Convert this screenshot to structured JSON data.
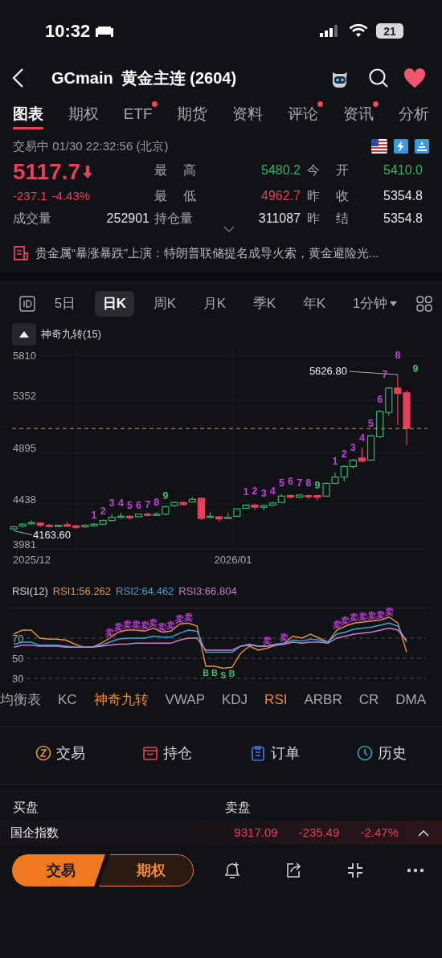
{
  "status_bar": {
    "time": "10:32",
    "battery": "21"
  },
  "header": {
    "symbol": "GCmain",
    "name": "黄金主连 (2604)",
    "favorite": true
  },
  "tabs": [
    {
      "label": "图表",
      "selected": true,
      "badge": false
    },
    {
      "label": "期权",
      "selected": false,
      "badge": false
    },
    {
      "label": "ETF",
      "selected": false,
      "badge": true
    },
    {
      "label": "期货",
      "selected": false,
      "badge": false
    },
    {
      "label": "资料",
      "selected": false,
      "badge": false
    },
    {
      "label": "评论",
      "selected": false,
      "badge": true
    },
    {
      "label": "资讯",
      "selected": false,
      "badge": true
    },
    {
      "label": "分析",
      "selected": false,
      "badge": false
    }
  ],
  "session": "交易中 01/30 22:32:56 (北京)",
  "quote": {
    "price": "5117.7",
    "change": "-237.1",
    "change_pct": "-4.43%",
    "color": "#e8405a"
  },
  "stats": [
    {
      "label": "最 高",
      "value": "5480.2",
      "color": "#34b36d"
    },
    {
      "label": "今 开",
      "value": "5410.0",
      "color": "#34b36d"
    },
    {
      "label": "最 低",
      "value": "4962.7",
      "color": "#e8405a"
    },
    {
      "label": "昨 收",
      "value": "5354.8",
      "color": "#e6e6e6"
    },
    {
      "label": "成交量",
      "value": "252901",
      "color": "#e6e6e6"
    },
    {
      "label": "持仓量",
      "value": "311087",
      "color": "#e6e6e6"
    },
    {
      "label": "昨 结",
      "value": "5354.8",
      "color": "#e6e6e6"
    }
  ],
  "news": "贵金属“暴涨暴跌”上演：特朗普联储提名成导火索，黄金避险光...",
  "periods": [
    {
      "label": "5日",
      "selected": false
    },
    {
      "label": "日K",
      "selected": true
    },
    {
      "label": "周K",
      "selected": false
    },
    {
      "label": "月K",
      "selected": false
    },
    {
      "label": "季K",
      "selected": false
    },
    {
      "label": "年K",
      "selected": false
    },
    {
      "label": "1分钟",
      "selected": false
    }
  ],
  "overlay_indicator": {
    "label": "神奇九转(15)",
    "expanded": true
  },
  "main_chart": {
    "y_labels": [
      "5810",
      "5352",
      "4895",
      "4438",
      "3981"
    ],
    "x_labels": [
      "2025/12",
      "2026/01"
    ],
    "high_label": "5626.80",
    "low_label": "4163.60",
    "nine_turn_labels": [
      {
        "text": "1",
        "color": "#c83ee0"
      },
      {
        "text": "2",
        "color": "#c83ee0"
      },
      {
        "text": "3",
        "color": "#c83ee0"
      },
      {
        "text": "4",
        "color": "#c83ee0"
      },
      {
        "text": "5",
        "color": "#c83ee0"
      },
      {
        "text": "6",
        "color": "#c83ee0"
      },
      {
        "text": "7",
        "color": "#c83ee0"
      },
      {
        "text": "8",
        "color": "#c83ee0"
      },
      {
        "text": "9",
        "color": "#3fbf6a"
      },
      {
        "text": "1",
        "color": "#c83ee0"
      },
      {
        "text": "2",
        "color": "#c83ee0"
      },
      {
        "text": "3",
        "color": "#c83ee0"
      },
      {
        "text": "4",
        "color": "#c83ee0"
      },
      {
        "text": "5",
        "color": "#c83ee0"
      },
      {
        "text": "6",
        "color": "#c83ee0"
      },
      {
        "text": "7",
        "color": "#c83ee0"
      },
      {
        "text": "8",
        "color": "#c83ee0"
      },
      {
        "text": "9",
        "color": "#3fbf6a"
      },
      {
        "text": "1",
        "color": "#c83ee0"
      },
      {
        "text": "2",
        "color": "#c83ee0"
      },
      {
        "text": "3",
        "color": "#c83ee0"
      },
      {
        "text": "4",
        "color": "#c83ee0"
      },
      {
        "text": "5",
        "color": "#c83ee0"
      },
      {
        "text": "6",
        "color": "#c83ee0"
      },
      {
        "text": "7",
        "color": "#c83ee0"
      },
      {
        "text": "8",
        "color": "#c83ee0"
      },
      {
        "text": "9",
        "color": "#3fbf6a"
      }
    ]
  },
  "rsi": {
    "title": "RSI(12)",
    "legend": [
      {
        "text": "RSI1:56.262",
        "color": "#e8913a"
      },
      {
        "text": "RSI2:64.462",
        "color": "#3aa6d8"
      },
      {
        "text": "RSI3:66.804",
        "color": "#d07ad8"
      }
    ],
    "signals": [
      {
        "text": "卖",
        "color": "#c83ee0"
      },
      {
        "text": "卖",
        "color": "#c83ee0"
      },
      {
        "text": "卖",
        "color": "#c83ee0"
      },
      {
        "text": "卖",
        "color": "#c83ee0"
      },
      {
        "text": "卖",
        "color": "#c83ee0"
      },
      {
        "text": "卖",
        "color": "#c83ee0"
      },
      {
        "text": "卖",
        "color": "#c83ee0"
      },
      {
        "text": "卖",
        "color": "#c83ee0"
      },
      {
        "text": "卖",
        "color": "#c83ee0"
      },
      {
        "text": "卖",
        "color": "#c83ee0"
      },
      {
        "text": "B",
        "color": "#3fbf6a"
      },
      {
        "text": "B",
        "color": "#3fbf6a"
      },
      {
        "text": "S",
        "color": "#3fbf6a"
      },
      {
        "text": "B",
        "color": "#3fbf6a"
      },
      {
        "text": "卖",
        "color": "#c83ee0"
      },
      {
        "text": "卖",
        "color": "#c83ee0"
      },
      {
        "text": "卖",
        "color": "#c83ee0"
      },
      {
        "text": "卖",
        "color": "#c83ee0"
      },
      {
        "text": "卖",
        "color": "#c83ee0"
      },
      {
        "text": "卖",
        "color": "#c83ee0"
      },
      {
        "text": "卖",
        "color": "#c83ee0"
      },
      {
        "text": "卖",
        "color": "#c83ee0"
      },
      {
        "text": "卖",
        "color": "#c83ee0"
      }
    ],
    "chart_data": {
      "type": "line",
      "ylim": [
        30,
        100
      ],
      "yticks": [
        30,
        50,
        70
      ],
      "grid": true,
      "series": [
        {
          "color": "#e8913a",
          "values": [
            74,
            78,
            78,
            70,
            69,
            69,
            68,
            64,
            61,
            61,
            65,
            70,
            76,
            78,
            78,
            77,
            80,
            76,
            77,
            84,
            85,
            82,
            42,
            42,
            40,
            41,
            55,
            62,
            58,
            60,
            63,
            65,
            72,
            70,
            74,
            70,
            66,
            78,
            82,
            85,
            86,
            87,
            88,
            91,
            85,
            56
          ]
        },
        {
          "color": "#3aa6d8",
          "values": [
            64,
            66,
            66,
            63,
            63,
            63,
            62,
            61,
            61,
            61,
            63,
            66,
            69,
            70,
            70,
            70,
            72,
            71,
            71,
            75,
            78,
            77,
            56,
            56,
            56,
            56,
            62,
            64,
            62,
            62,
            64,
            65,
            68,
            67,
            69,
            68,
            66,
            74,
            76,
            79,
            80,
            81,
            83,
            85,
            82,
            66
          ]
        },
        {
          "color": "#d07ad8",
          "values": [
            61,
            63,
            63,
            62,
            62,
            62,
            61,
            61,
            61,
            61,
            62,
            63,
            64,
            64,
            65,
            65,
            65,
            65,
            65,
            68,
            70,
            70,
            58,
            58,
            58,
            58,
            62,
            63,
            62,
            62,
            63,
            64,
            66,
            65,
            66,
            66,
            65,
            70,
            72,
            74,
            75,
            76,
            78,
            80,
            78,
            68
          ]
        }
      ]
    }
  },
  "indicators": [
    {
      "label": "均衡表",
      "selected": false
    },
    {
      "label": "KC",
      "selected": false
    },
    {
      "label": "神奇九转",
      "selected": true
    },
    {
      "label": "VWAP",
      "selected": false
    },
    {
      "label": "KDJ",
      "selected": false
    },
    {
      "label": "RSI",
      "selected": true
    },
    {
      "label": "ARBR",
      "selected": false
    },
    {
      "label": "CR",
      "selected": false
    },
    {
      "label": "DMA",
      "selected": false
    }
  ],
  "actions": [
    {
      "label": "交易",
      "kind": "trade"
    },
    {
      "label": "持仓",
      "kind": "position"
    },
    {
      "label": "订单",
      "kind": "order"
    },
    {
      "label": "历史",
      "kind": "history"
    }
  ],
  "order_book": {
    "bid_label": "买盘",
    "ask_label": "卖盘"
  },
  "ticker": {
    "name": "国企指数",
    "value": "9317.09",
    "change": "-235.49",
    "change_pct": "-2.47%",
    "color": "#e8405a"
  },
  "bottom_bar": {
    "trade_button": "交易",
    "options_button": "期权"
  }
}
